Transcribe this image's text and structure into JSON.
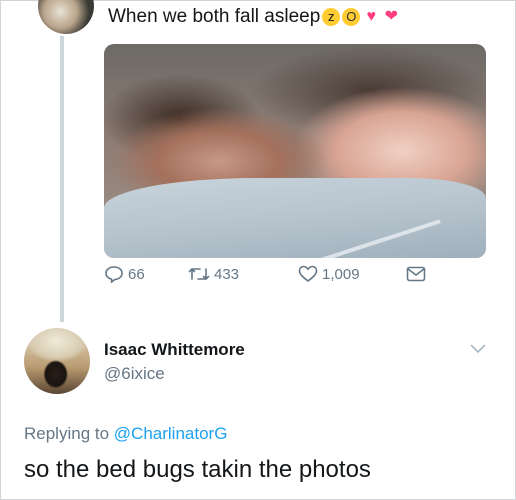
{
  "top_tweet": {
    "text": "When we both fall asleep",
    "emojis": [
      "sleeping-face",
      "screaming-face",
      "two-hearts",
      "sparkling-heart"
    ],
    "stats": {
      "replies": "66",
      "retweets": "433",
      "likes": "1,009"
    }
  },
  "reply_tweet": {
    "display_name": "Isaac Whittemore",
    "handle": "@6ixice",
    "replying_prefix": "Replying to ",
    "replying_mention": "@CharlinatorG",
    "text": "so the bed bugs takin the photos"
  },
  "colors": {
    "text": "#14171a",
    "muted": "#657786",
    "link": "#1da1f2",
    "thread_line": "#ccd6dd"
  }
}
